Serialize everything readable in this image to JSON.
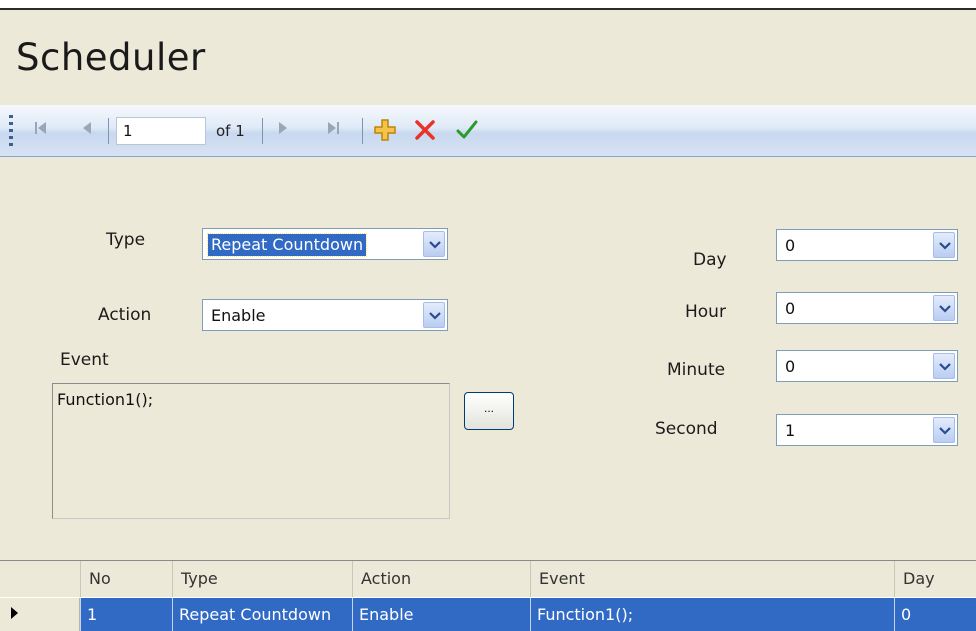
{
  "title": "Scheduler",
  "navigator": {
    "position": "1",
    "of_label": "of 1",
    "first_icon": "move-first-icon",
    "prev_icon": "move-previous-icon",
    "next_icon": "move-next-icon",
    "last_icon": "move-last-icon",
    "add_icon": "add-new-icon",
    "delete_icon": "delete-icon",
    "save_icon": "save-check-icon"
  },
  "form": {
    "type_label": "Type",
    "type_value": "Repeat Countdown",
    "action_label": "Action",
    "action_value": "Enable",
    "event_label": "Event",
    "event_value": "Function1();",
    "browse_label": "...",
    "day_label": "Day",
    "day_value": "0",
    "hour_label": "Hour",
    "hour_value": "0",
    "minute_label": "Minute",
    "minute_value": "0",
    "second_label": "Second",
    "second_value": "1"
  },
  "grid": {
    "columns": [
      "No",
      "Type",
      "Action",
      "Event",
      "Day"
    ],
    "rows": [
      [
        "1",
        "Repeat Countdown",
        "Enable",
        "Function1();",
        "0"
      ]
    ]
  },
  "colors": {
    "selection": "#316ac5",
    "window": "#ece9d8",
    "delete": "#e8332a",
    "check": "#2a9a2a",
    "add": "#f0b020"
  }
}
